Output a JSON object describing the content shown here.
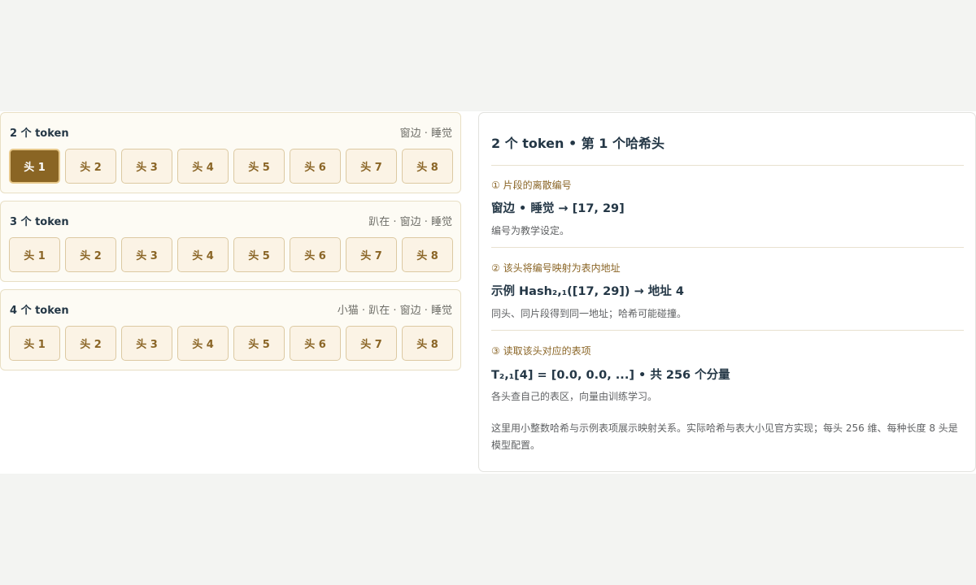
{
  "groups": [
    {
      "title": "2 个 token",
      "tokens": "窗边 · 睡觉",
      "active_head": 0
    },
    {
      "title": "3 个 token",
      "tokens": "趴在 · 窗边 · 睡觉",
      "active_head": -1
    },
    {
      "title": "4 个 token",
      "tokens": "小猫 · 趴在 · 窗边 · 睡觉",
      "active_head": -1
    }
  ],
  "head_labels": [
    "头 1",
    "头 2",
    "头 3",
    "头 4",
    "头 5",
    "头 6",
    "头 7",
    "头 8"
  ],
  "colors": {
    "accent": "#8a6524",
    "head_bg": "#fbf3e5",
    "head_text": "#8a6526"
  },
  "detail": {
    "title": "2 个 token • 第 1 个哈希头",
    "steps": [
      {
        "label": "① 片段的离散编号",
        "main": "窗边 • 睡觉 → [17, 29]",
        "note": "编号为教学设定。"
      },
      {
        "label": "② 该头将编号映射为表内地址",
        "main": "示例 Hash₂,₁([17, 29]) → 地址 4",
        "note": "同头、同片段得到同一地址；哈希可能碰撞。"
      },
      {
        "label": "③ 读取该头对应的表项",
        "main": "T₂,₁[4] = [0.0, 0.0, ...] • 共 256 个分量",
        "note": "各头查自己的表区，向量由训练学习。"
      }
    ],
    "footer": "这里用小整数哈希与示例表项展示映射关系。实际哈希与表大小见官方实现；每头 256 维、每种长度 8 头是模型配置。"
  }
}
